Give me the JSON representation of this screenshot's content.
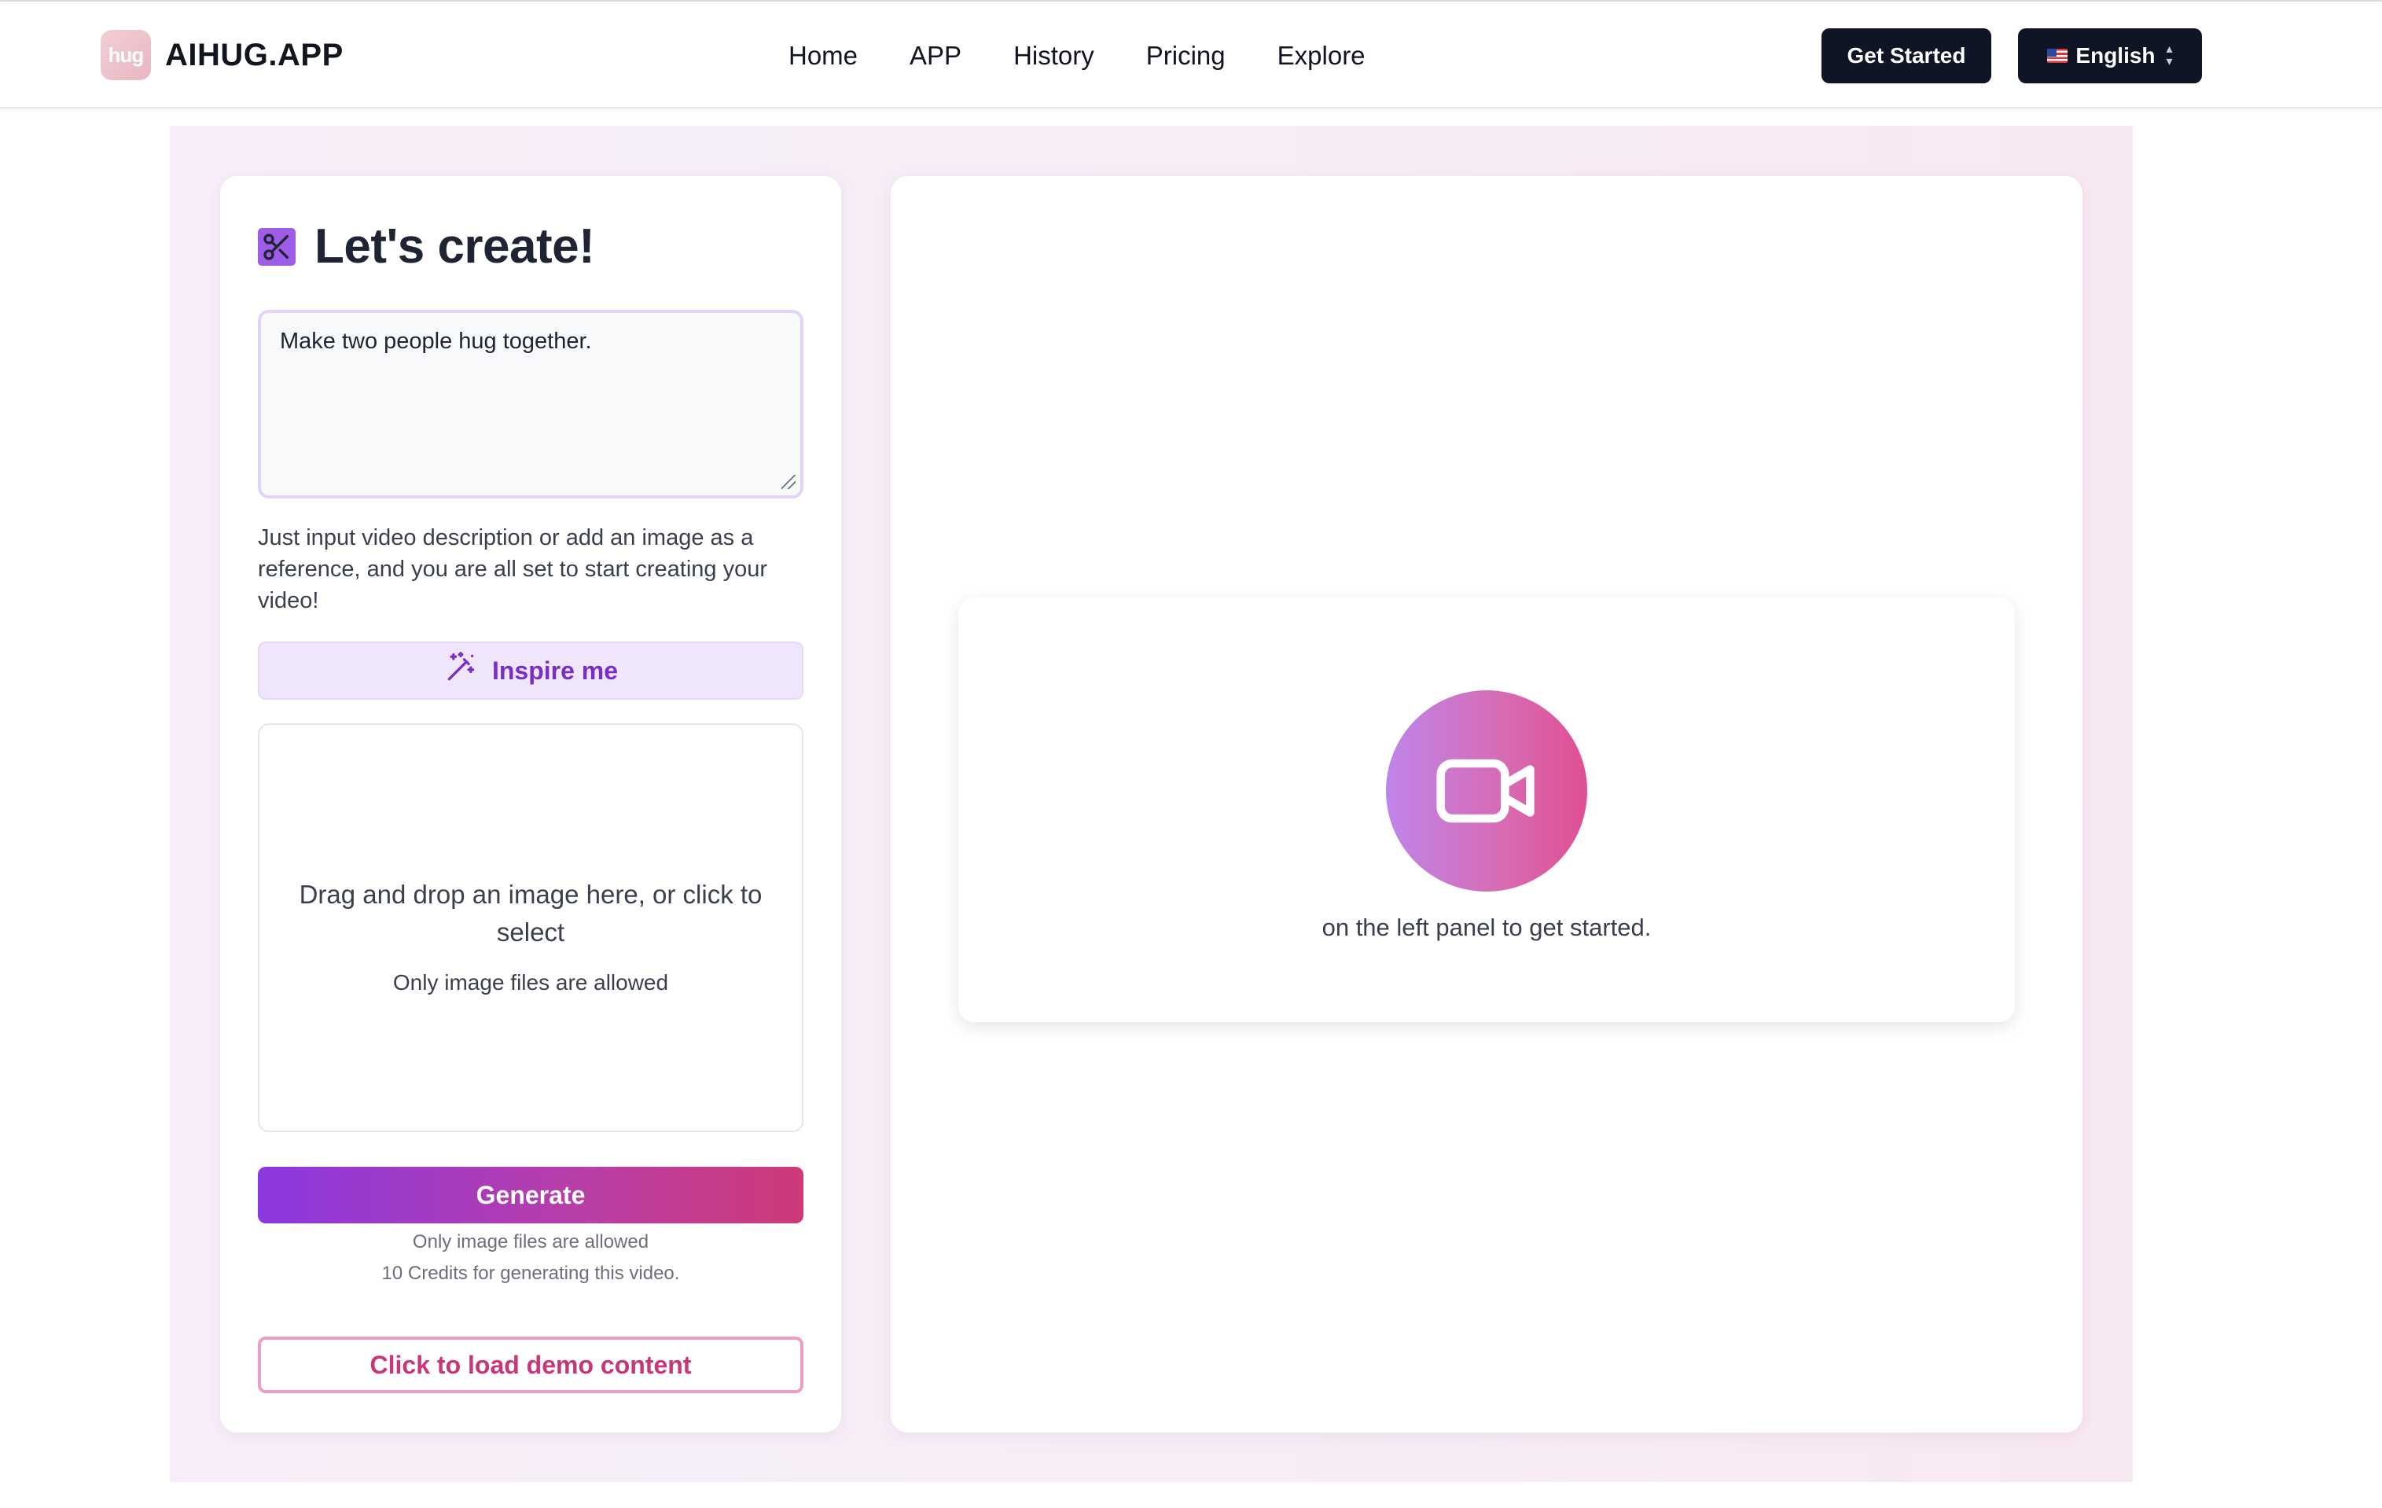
{
  "brand": {
    "logo_mark": "hug",
    "name": "AIHUG.APP"
  },
  "nav": {
    "items": [
      {
        "label": "Home"
      },
      {
        "label": "APP"
      },
      {
        "label": "History"
      },
      {
        "label": "Pricing"
      },
      {
        "label": "Explore"
      }
    ]
  },
  "header": {
    "get_started_label": "Get Started",
    "language_label": "English"
  },
  "creator": {
    "title": "Let's create!",
    "prompt_value": "Make two people hug together.",
    "hint": "Just input video description or add an image as a reference, and you are all set to start creating your video!",
    "inspire_label": "Inspire me",
    "dropzone": {
      "main_text": "Drag and drop an image here, or click to select",
      "sub_text": "Only image files are allowed"
    },
    "generate_label": "Generate",
    "note_files": "Only image files are allowed",
    "note_credits": "10 Credits for generating this video.",
    "demo_label": "Click to load demo content"
  },
  "preview": {
    "empty_text": "on the left panel to get started."
  },
  "colors": {
    "accent_purple": "#8a38e0",
    "accent_pink": "#cd3a77",
    "dark_button": "#0f1524",
    "inspire_text": "#7a2ec4"
  },
  "icons": {
    "title_icon": "scissors-icon",
    "inspire_icon": "magic-wand-icon",
    "preview_icon": "video-camera-icon"
  }
}
